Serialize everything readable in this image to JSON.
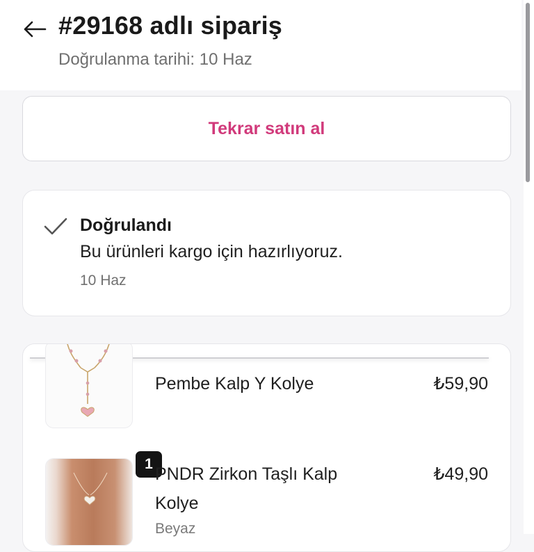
{
  "header": {
    "back_icon": "arrow-left-icon",
    "title": "#29168 adlı sipariş",
    "subtitle": "Doğrulanma tarihi: 10 Haz"
  },
  "actions": {
    "rebuy_label": "Tekrar satın al",
    "accent_color": "#d13a7b"
  },
  "status": {
    "icon": "checkmark-icon",
    "title": "Doğrulandı",
    "description": "Bu ürünleri kargo için hazırlıyoruz.",
    "date": "10 Haz"
  },
  "items": [
    {
      "name": "Pembe Kalp Y Kolye",
      "price": "₺59,90",
      "thumbnail": "necklace-thumbnail"
    },
    {
      "name": "PNDR Zirkon Taşlı Kalp Kolye",
      "price": "₺49,90",
      "variant": "Beyaz",
      "quantity": "1",
      "thumbnail": "necklace-photo-thumbnail"
    }
  ]
}
